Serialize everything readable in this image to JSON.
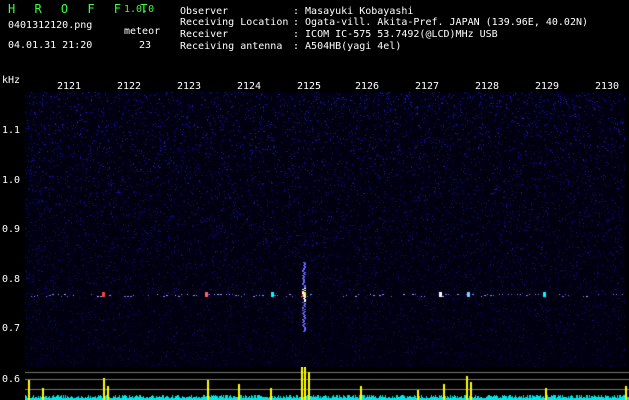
{
  "app": {
    "name": "H R O F F T",
    "version": "1.0.0"
  },
  "file": {
    "name": "0401312120.png",
    "timestamp": "04.01.31 21:20"
  },
  "meteor": {
    "label": "meteor",
    "count": "23"
  },
  "info": [
    {
      "label": "Observer",
      "value": ": Masayuki Kobayashi"
    },
    {
      "label": "Receiving Location",
      "value": ": Ogata-vill. Akita-Pref. JAPAN (139.96E, 40.02N)"
    },
    {
      "label": "Receiver",
      "value": ": ICOM IC-575 53.7492(@LCD)MHz USB"
    },
    {
      "label": "Receiving antenna",
      "value": ": A504HB(yagi 4el)"
    }
  ],
  "x_axis": {
    "ticks": [
      "2121",
      "2122",
      "2123",
      "2124",
      "2125",
      "2126",
      "2127",
      "2128",
      "2129",
      "2130"
    ]
  },
  "y_axis": {
    "unit": "kHz",
    "ticks": [
      "1.1",
      "1.0",
      "0.9",
      "0.8",
      "0.7",
      "0.6"
    ]
  },
  "colors": {
    "title_green": "#3cff3c",
    "background": "#000000",
    "noise": "#1a1aff",
    "trace_yellow": "#ffff00",
    "trace_cyan": "#00ffff"
  }
}
